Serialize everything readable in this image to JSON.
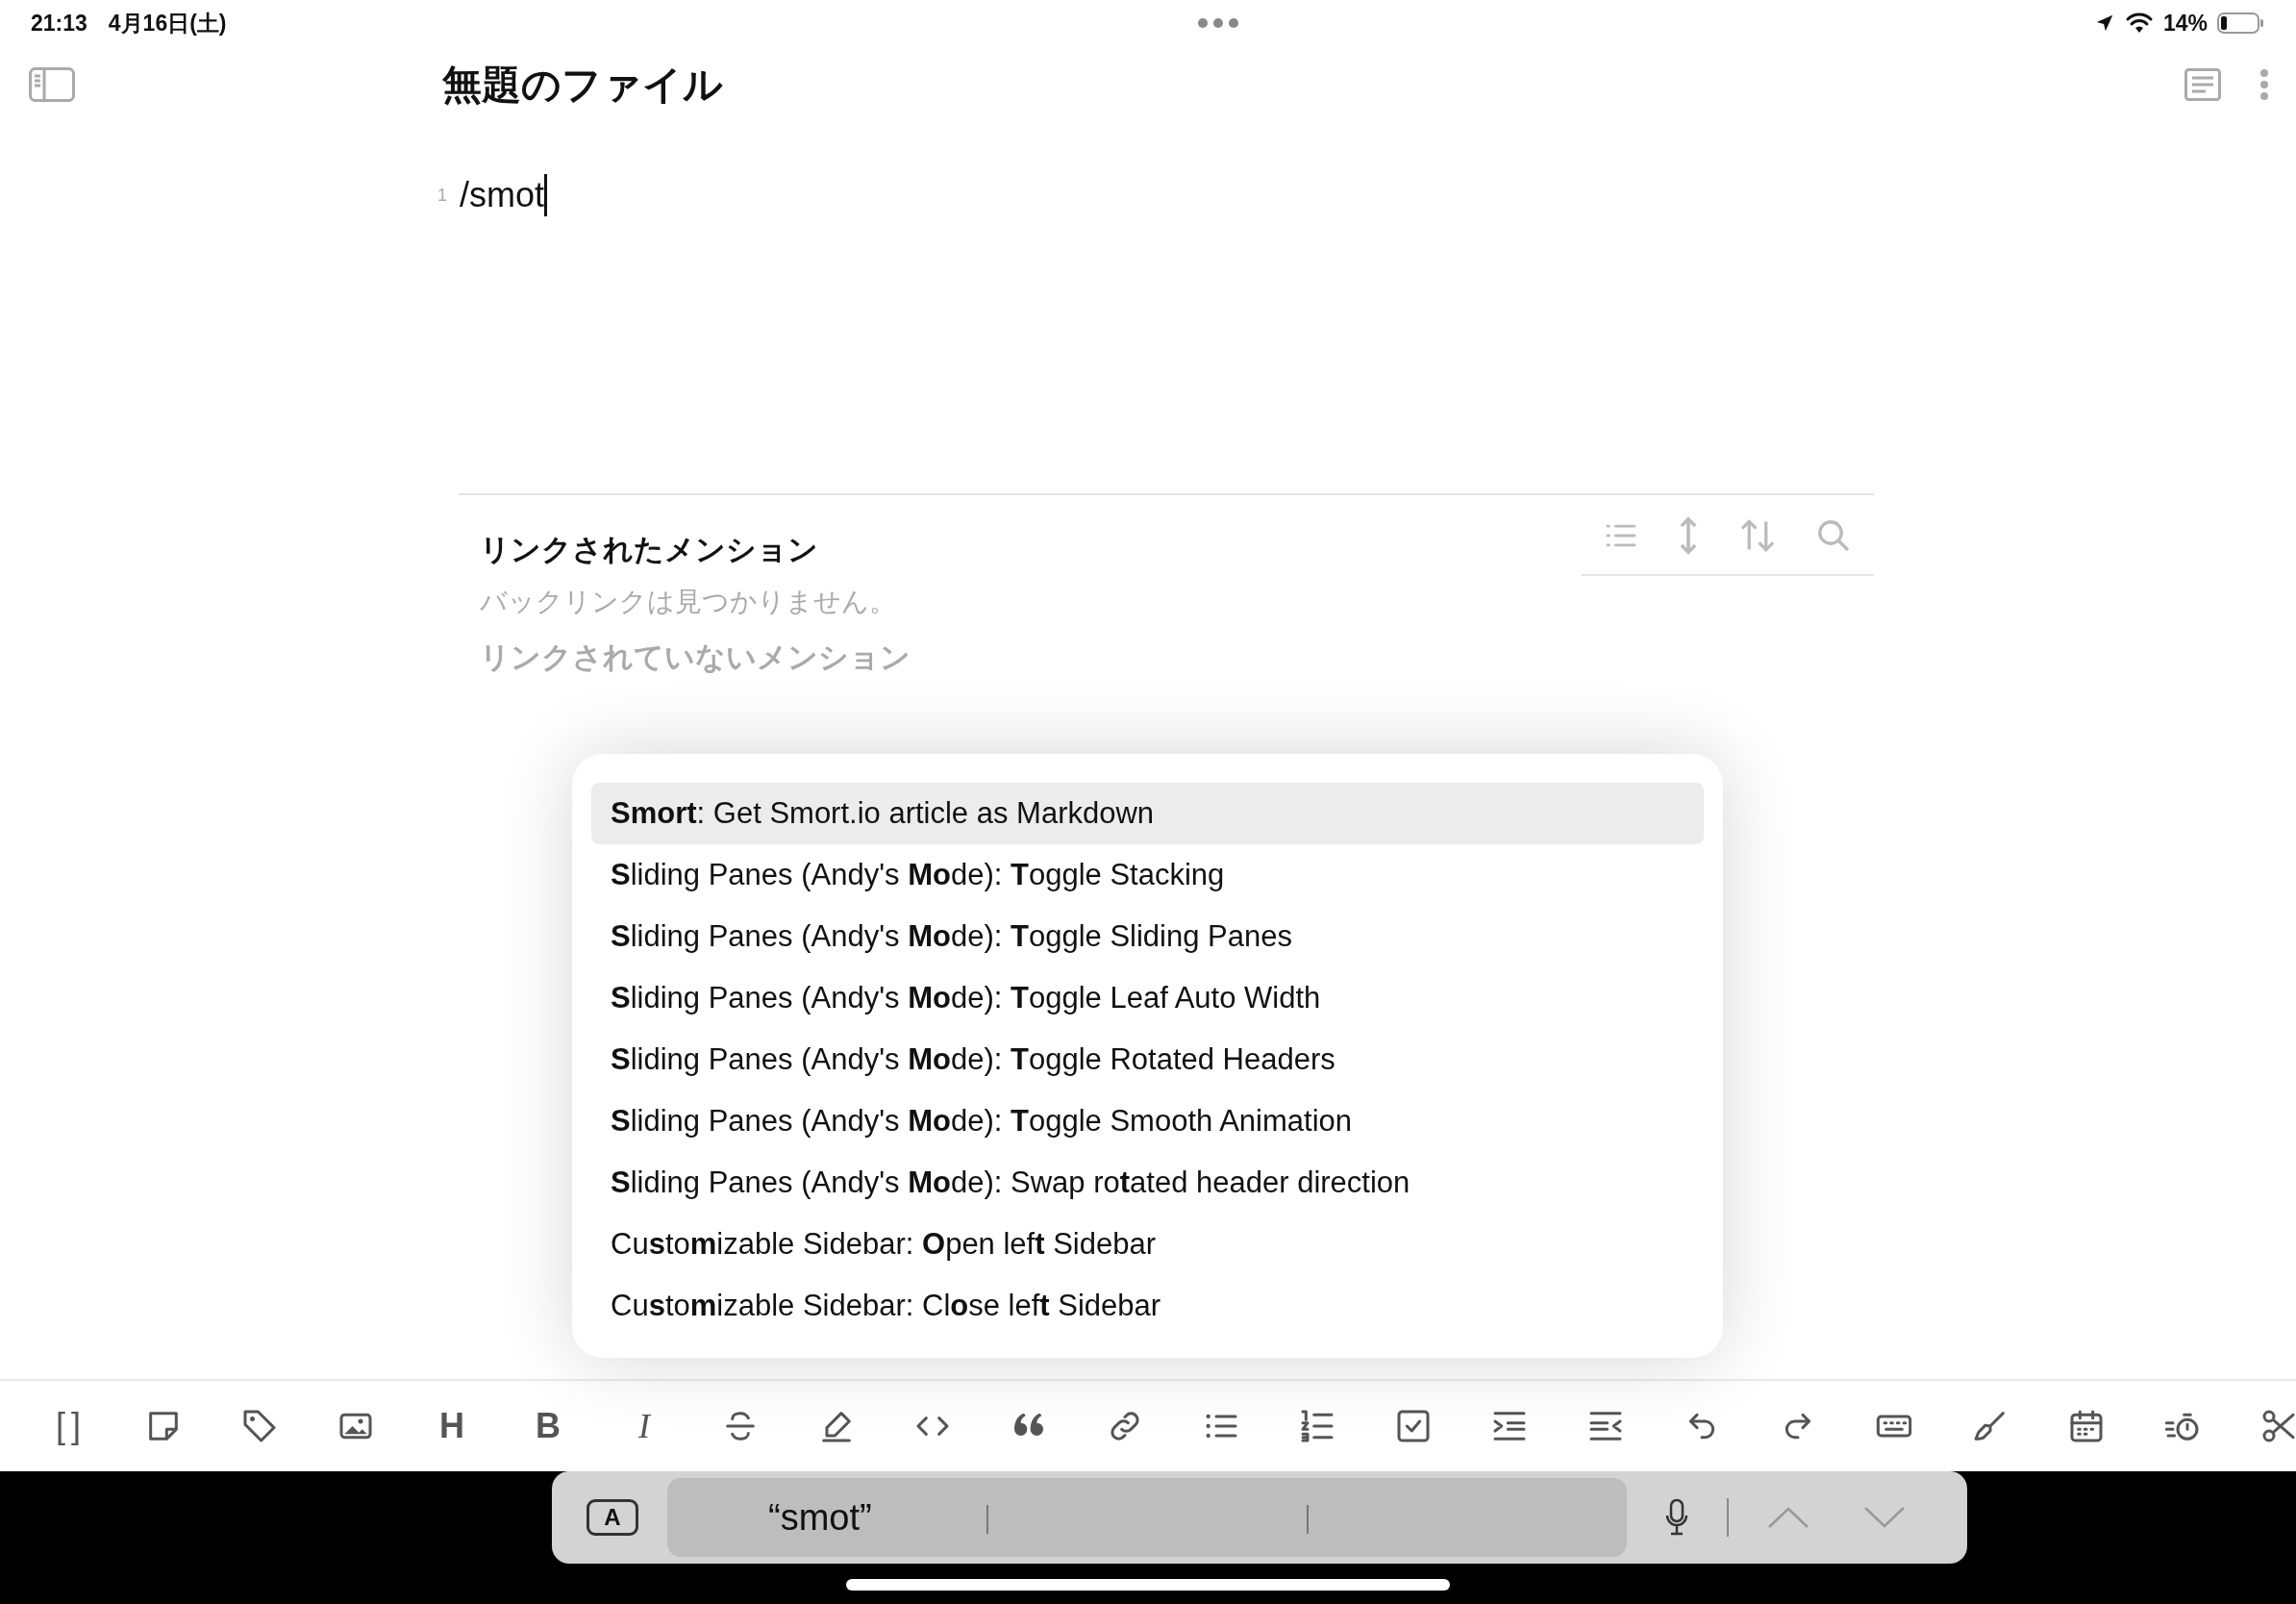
{
  "status_bar": {
    "time": "21:13",
    "date": "4月16日(土)",
    "battery": "14%"
  },
  "document": {
    "title": "無題のファイル",
    "lines": [
      {
        "number": "1",
        "text": "/smot"
      }
    ]
  },
  "linked_mentions": {
    "title": "リンクされたメンション",
    "empty_message": "バックリンクは見つかりません。"
  },
  "unlinked_mentions": {
    "title": "リンクされていないメンション"
  },
  "command_suggestions": [
    {
      "text": "**Smort**: Get Smort.io article as Markdown",
      "selected": true
    },
    {
      "text": "**S**liding Panes (Andy's **Mo**de): **T**oggle Stacking",
      "selected": false
    },
    {
      "text": "**S**liding Panes (Andy's **Mo**de): **T**oggle Sliding Panes",
      "selected": false
    },
    {
      "text": "**S**liding Panes (Andy's **Mo**de): **T**oggle Leaf Auto Width",
      "selected": false
    },
    {
      "text": "**S**liding Panes (Andy's **Mo**de): **T**oggle Rotated Headers",
      "selected": false
    },
    {
      "text": "**S**liding Panes (Andy's **Mo**de): **T**oggle Smooth Animation",
      "selected": false
    },
    {
      "text": "**S**liding Panes (Andy's **Mo**de): Swap ro**t**ated header direction",
      "selected": false
    },
    {
      "text": "Cu**s**to**m**izable Sidebar: **O**pen lef**t** Sidebar",
      "selected": false
    },
    {
      "text": "Cu**s**to**m**izable Sidebar: Cl**o**se lef**t** Sidebar",
      "selected": false
    }
  ],
  "toolbar": [
    {
      "kind": "glyph",
      "text": "[ ]"
    },
    {
      "kind": "icon"
    },
    {
      "kind": "icon"
    },
    {
      "kind": "icon"
    },
    {
      "kind": "glyph",
      "text": "H"
    },
    {
      "kind": "glyph",
      "text": "B"
    },
    {
      "kind": "glyph-italic",
      "text": "I"
    },
    {
      "kind": "icon"
    },
    {
      "kind": "icon"
    },
    {
      "kind": "icon"
    },
    {
      "kind": "icon"
    },
    {
      "kind": "icon"
    },
    {
      "kind": "icon"
    },
    {
      "kind": "icon"
    },
    {
      "kind": "icon"
    },
    {
      "kind": "icon"
    },
    {
      "kind": "icon"
    },
    {
      "kind": "icon"
    },
    {
      "kind": "icon"
    },
    {
      "kind": "icon"
    },
    {
      "kind": "icon"
    },
    {
      "kind": "icon"
    },
    {
      "kind": "icon"
    },
    {
      "kind": "icon"
    }
  ],
  "keyboard_bar": {
    "format_key": "A",
    "suggestion": "“smot”"
  }
}
